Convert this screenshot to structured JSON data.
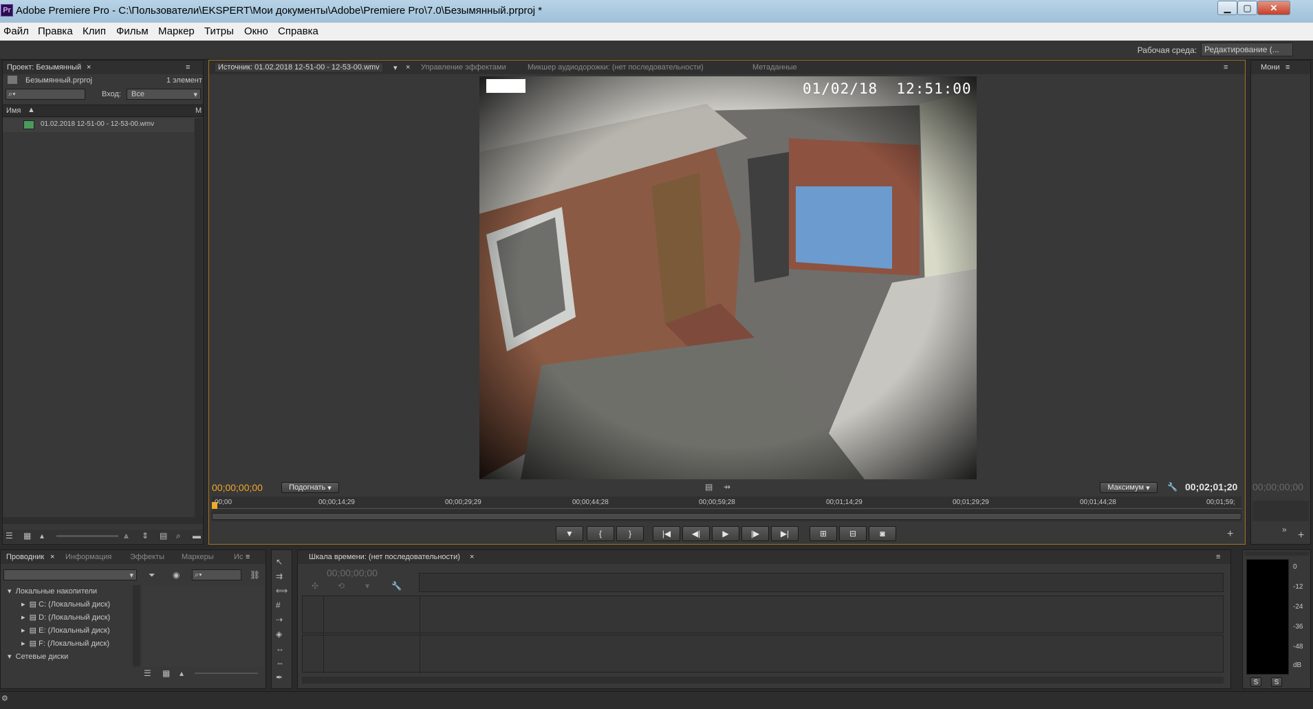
{
  "window": {
    "title": "Adobe Premiere Pro - C:\\Пользователи\\EKSPERT\\Мои документы\\Adobe\\Premiere Pro\\7.0\\Безымянный.prproj *",
    "logo_text": "Pr",
    "minimize": "▁",
    "maximize": "▢",
    "close": "✕"
  },
  "menu": [
    "Файл",
    "Правка",
    "Клип",
    "Фильм",
    "Маркер",
    "Титры",
    "Окно",
    "Справка"
  ],
  "workspace": {
    "label": "Рабочая среда:",
    "value": "Редактирование (..."
  },
  "project_panel": {
    "tab": "Проект: Безымянный",
    "file": "Безымянный.prproj",
    "count": "1 элемент",
    "search_placeholder": "",
    "in_label": "Вход:",
    "in_value": "Все",
    "col_name": "Имя",
    "col_m": "М",
    "items": [
      "01.02.2018 12-51-00 - 12-53-00.wmv"
    ]
  },
  "source_panel": {
    "tabs": [
      "Источник: 01.02.2018 12-51-00 - 12-53-00.wmv",
      "Управление эффектами",
      "Микшер аудиодорожки: (нет последовательности)",
      "Метаданные"
    ],
    "video_overlay_text": "01/02/18  12:51:00",
    "timecode_current": "00;00;00;00",
    "fit": "Подогнать",
    "quality": "Максимум",
    "timecode_duration": "00;02;01;20",
    "ruler": [
      "00;00",
      "00;00;14;29",
      "00;00;29;29",
      "00;00;44;28",
      "00;00;59;28",
      "00;01;14;29",
      "00;01;29;29",
      "00;01;44;28",
      "00;01;59;"
    ],
    "controls": [
      "▼",
      "{",
      "}",
      "|◀",
      "◀|",
      "▶",
      "|▶",
      "▶|"
    ]
  },
  "program_panel": {
    "tab": "Мони",
    "timecode": "00;00;00;00"
  },
  "browser_panel": {
    "tabs": [
      "Проводник",
      "Информация",
      "Эффекты",
      "Маркеры",
      "Ис"
    ],
    "tree": [
      {
        "label": "Локальные накопители",
        "level": 0,
        "expanded": true
      },
      {
        "label": "C: (Локальный диск)",
        "level": 1
      },
      {
        "label": "D: (Локальный диск)",
        "level": 1
      },
      {
        "label": "E: (Локальный диск)",
        "level": 1
      },
      {
        "label": "F: (Локальный диск)",
        "level": 1
      },
      {
        "label": "Сетевые диски",
        "level": 0,
        "expanded": true
      }
    ]
  },
  "timeline_panel": {
    "tab": "Шкала времени: (нет последовательности)",
    "timecode": "00;00;00;00"
  },
  "audio_meter": {
    "labels": [
      "0",
      "-12",
      "-24",
      "-36",
      "-48",
      "dB"
    ],
    "solo": [
      "S",
      "S"
    ]
  }
}
